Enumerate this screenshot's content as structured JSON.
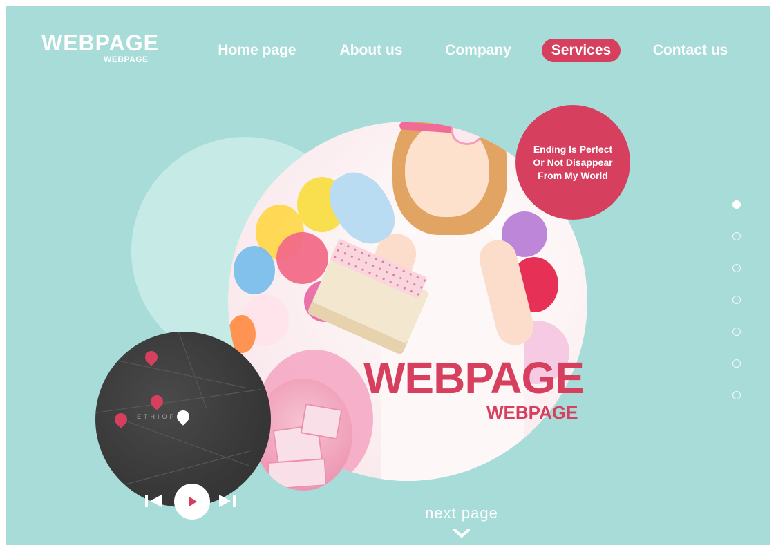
{
  "logo": {
    "main": "WEBPAGE",
    "sub": "WEBPAGE"
  },
  "nav": {
    "items": [
      {
        "label": "Home page",
        "active": false
      },
      {
        "label": "About us",
        "active": false
      },
      {
        "label": "Company",
        "active": false
      },
      {
        "label": "Services",
        "active": true
      },
      {
        "label": "Contact us",
        "active": false
      }
    ]
  },
  "badge": {
    "line1": "Ending Is Perfect",
    "line2": "Or Not Disappear",
    "line3": "From My World"
  },
  "hero": {
    "title": "WEBPAGE",
    "subtitle": "WEBPAGE"
  },
  "map": {
    "label": "ETHIOP"
  },
  "pager": {
    "count": 7,
    "active_index": 0
  },
  "next_page": {
    "label": "next page"
  },
  "colors": {
    "background": "#a7dcd8",
    "accent": "#d6405e",
    "white": "#ffffff"
  }
}
